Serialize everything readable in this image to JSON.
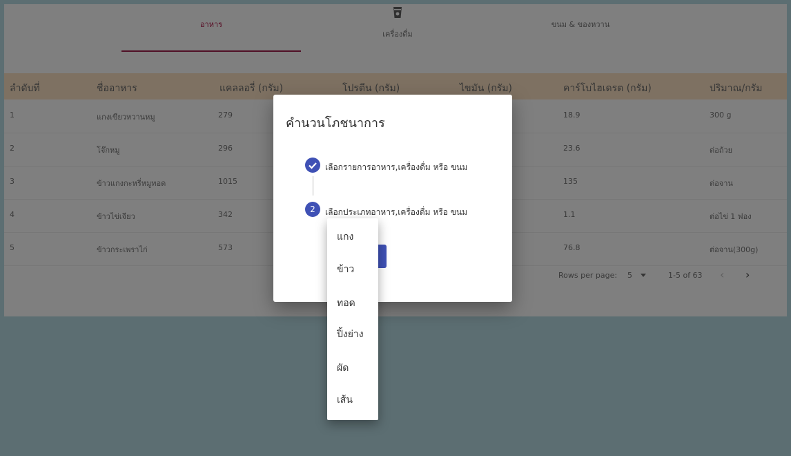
{
  "tabs": [
    {
      "label": "อาหาร"
    },
    {
      "label": "เครื่องดื่ม",
      "icon": "cup-icon"
    },
    {
      "label": "ขนม & ของหวาน"
    }
  ],
  "table": {
    "headers": [
      "ลำดับที่",
      "ชื่ออาหาร",
      "แคลลอรี่ (กรัม)",
      "โปรตีน (กรัม)",
      "ไขมัน (กรัม)",
      "คาร์โบไฮเดรต (กรัม)",
      "ปริมาณ/กรัม"
    ],
    "rows": [
      [
        "1",
        "แกงเขียวหวานหมู",
        "279",
        "18.9",
        "300 g"
      ],
      [
        "2",
        "โจ๊กหมู",
        "296",
        "23.6",
        "ต่อถ้วย"
      ],
      [
        "3",
        "ข้าวแกงกะหรี่หมูทอด",
        "1015",
        "135",
        "ต่อจาน"
      ],
      [
        "4",
        "ข้าวไข่เจียว",
        "342",
        "1.1",
        "ต่อไข่ 1 ฟอง"
      ],
      [
        "5",
        "ข้าวกระเพราไก่",
        "573",
        "76.8",
        "ต่อจาน(300g)"
      ]
    ]
  },
  "pagination": {
    "rows_per_page_label": "Rows per page:",
    "rows_per_page_value": "5",
    "range": "1-5 of 63",
    "prev_icon": "chevron-left-icon",
    "next_icon": "chevron-right-icon"
  },
  "dialog": {
    "title": "คำนวนโภชนาการ",
    "steps": [
      {
        "number": "1",
        "label": "เลือกรายการอาหาร,เครื่องดื่ม หรือ ขนม",
        "state": "completed"
      },
      {
        "number": "2",
        "label": "เลือกประเภทอาหาร,เครื่องดื่ม หรือ ขนม",
        "state": "active"
      }
    ]
  },
  "menu": {
    "items": [
      "แกง",
      "ข้าว",
      "ทอด",
      "ปิ้งย่าง",
      "ผัด",
      "เส้น"
    ]
  },
  "colors": {
    "accent": "#a0204d",
    "primary": "#3f51b5",
    "header_bg": "#fde3c4"
  }
}
